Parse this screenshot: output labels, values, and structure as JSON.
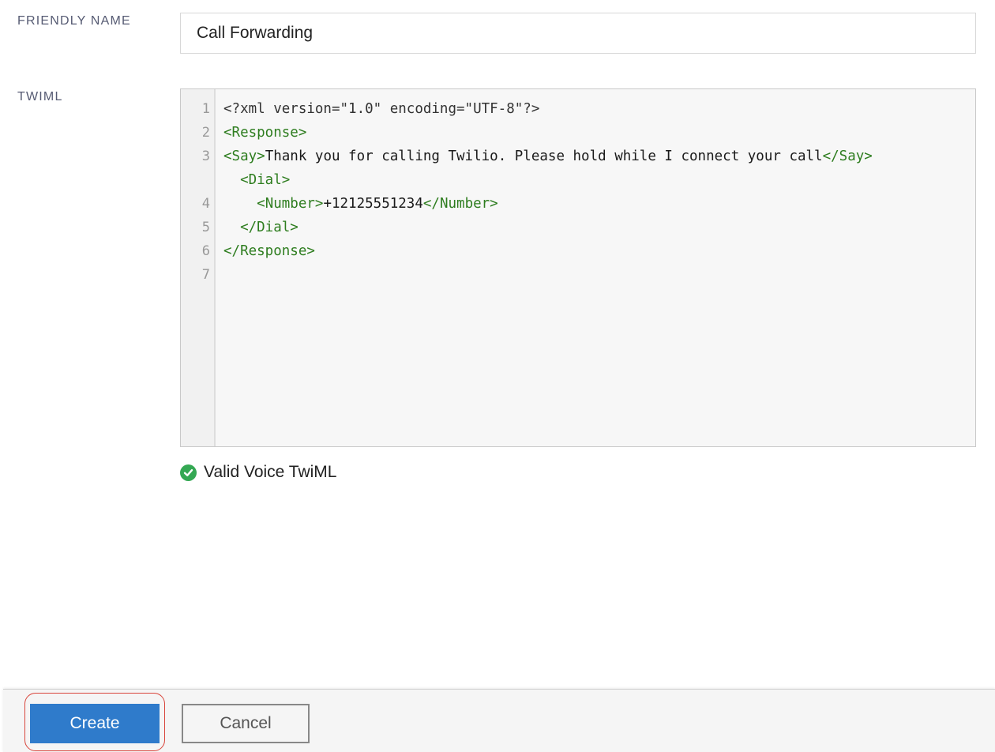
{
  "form": {
    "friendly_name_label": "FRIENDLY NAME",
    "friendly_name_value": "Call Forwarding",
    "twiml_label": "TWIML"
  },
  "editor": {
    "line_numbers": [
      "1",
      "2",
      "3",
      "4",
      "5",
      "6",
      "7"
    ],
    "lines": {
      "l1": "<?xml version=\"1.0\" encoding=\"UTF-8\"?>",
      "l2": "<Response>",
      "l3_open": "<Say>",
      "l3_text": "Thank you for calling Twilio. Please hold while I connect your call",
      "l3_close": "</Say>",
      "l4": "<Dial>",
      "l5_open": "<Number>",
      "l5_text": "+12125551234",
      "l5_close": "</Number>",
      "l6": "</Dial>",
      "l7": "</Response>"
    },
    "indent": {
      "l4": "  ",
      "l5": "    ",
      "l6": "  "
    }
  },
  "validation": {
    "message": "Valid Voice TwiML",
    "icon": "check-circle-icon",
    "color": "#34a853"
  },
  "footer": {
    "create_label": "Create",
    "cancel_label": "Cancel",
    "create_color": "#2f7bcb",
    "highlight_color": "#d9453b"
  }
}
